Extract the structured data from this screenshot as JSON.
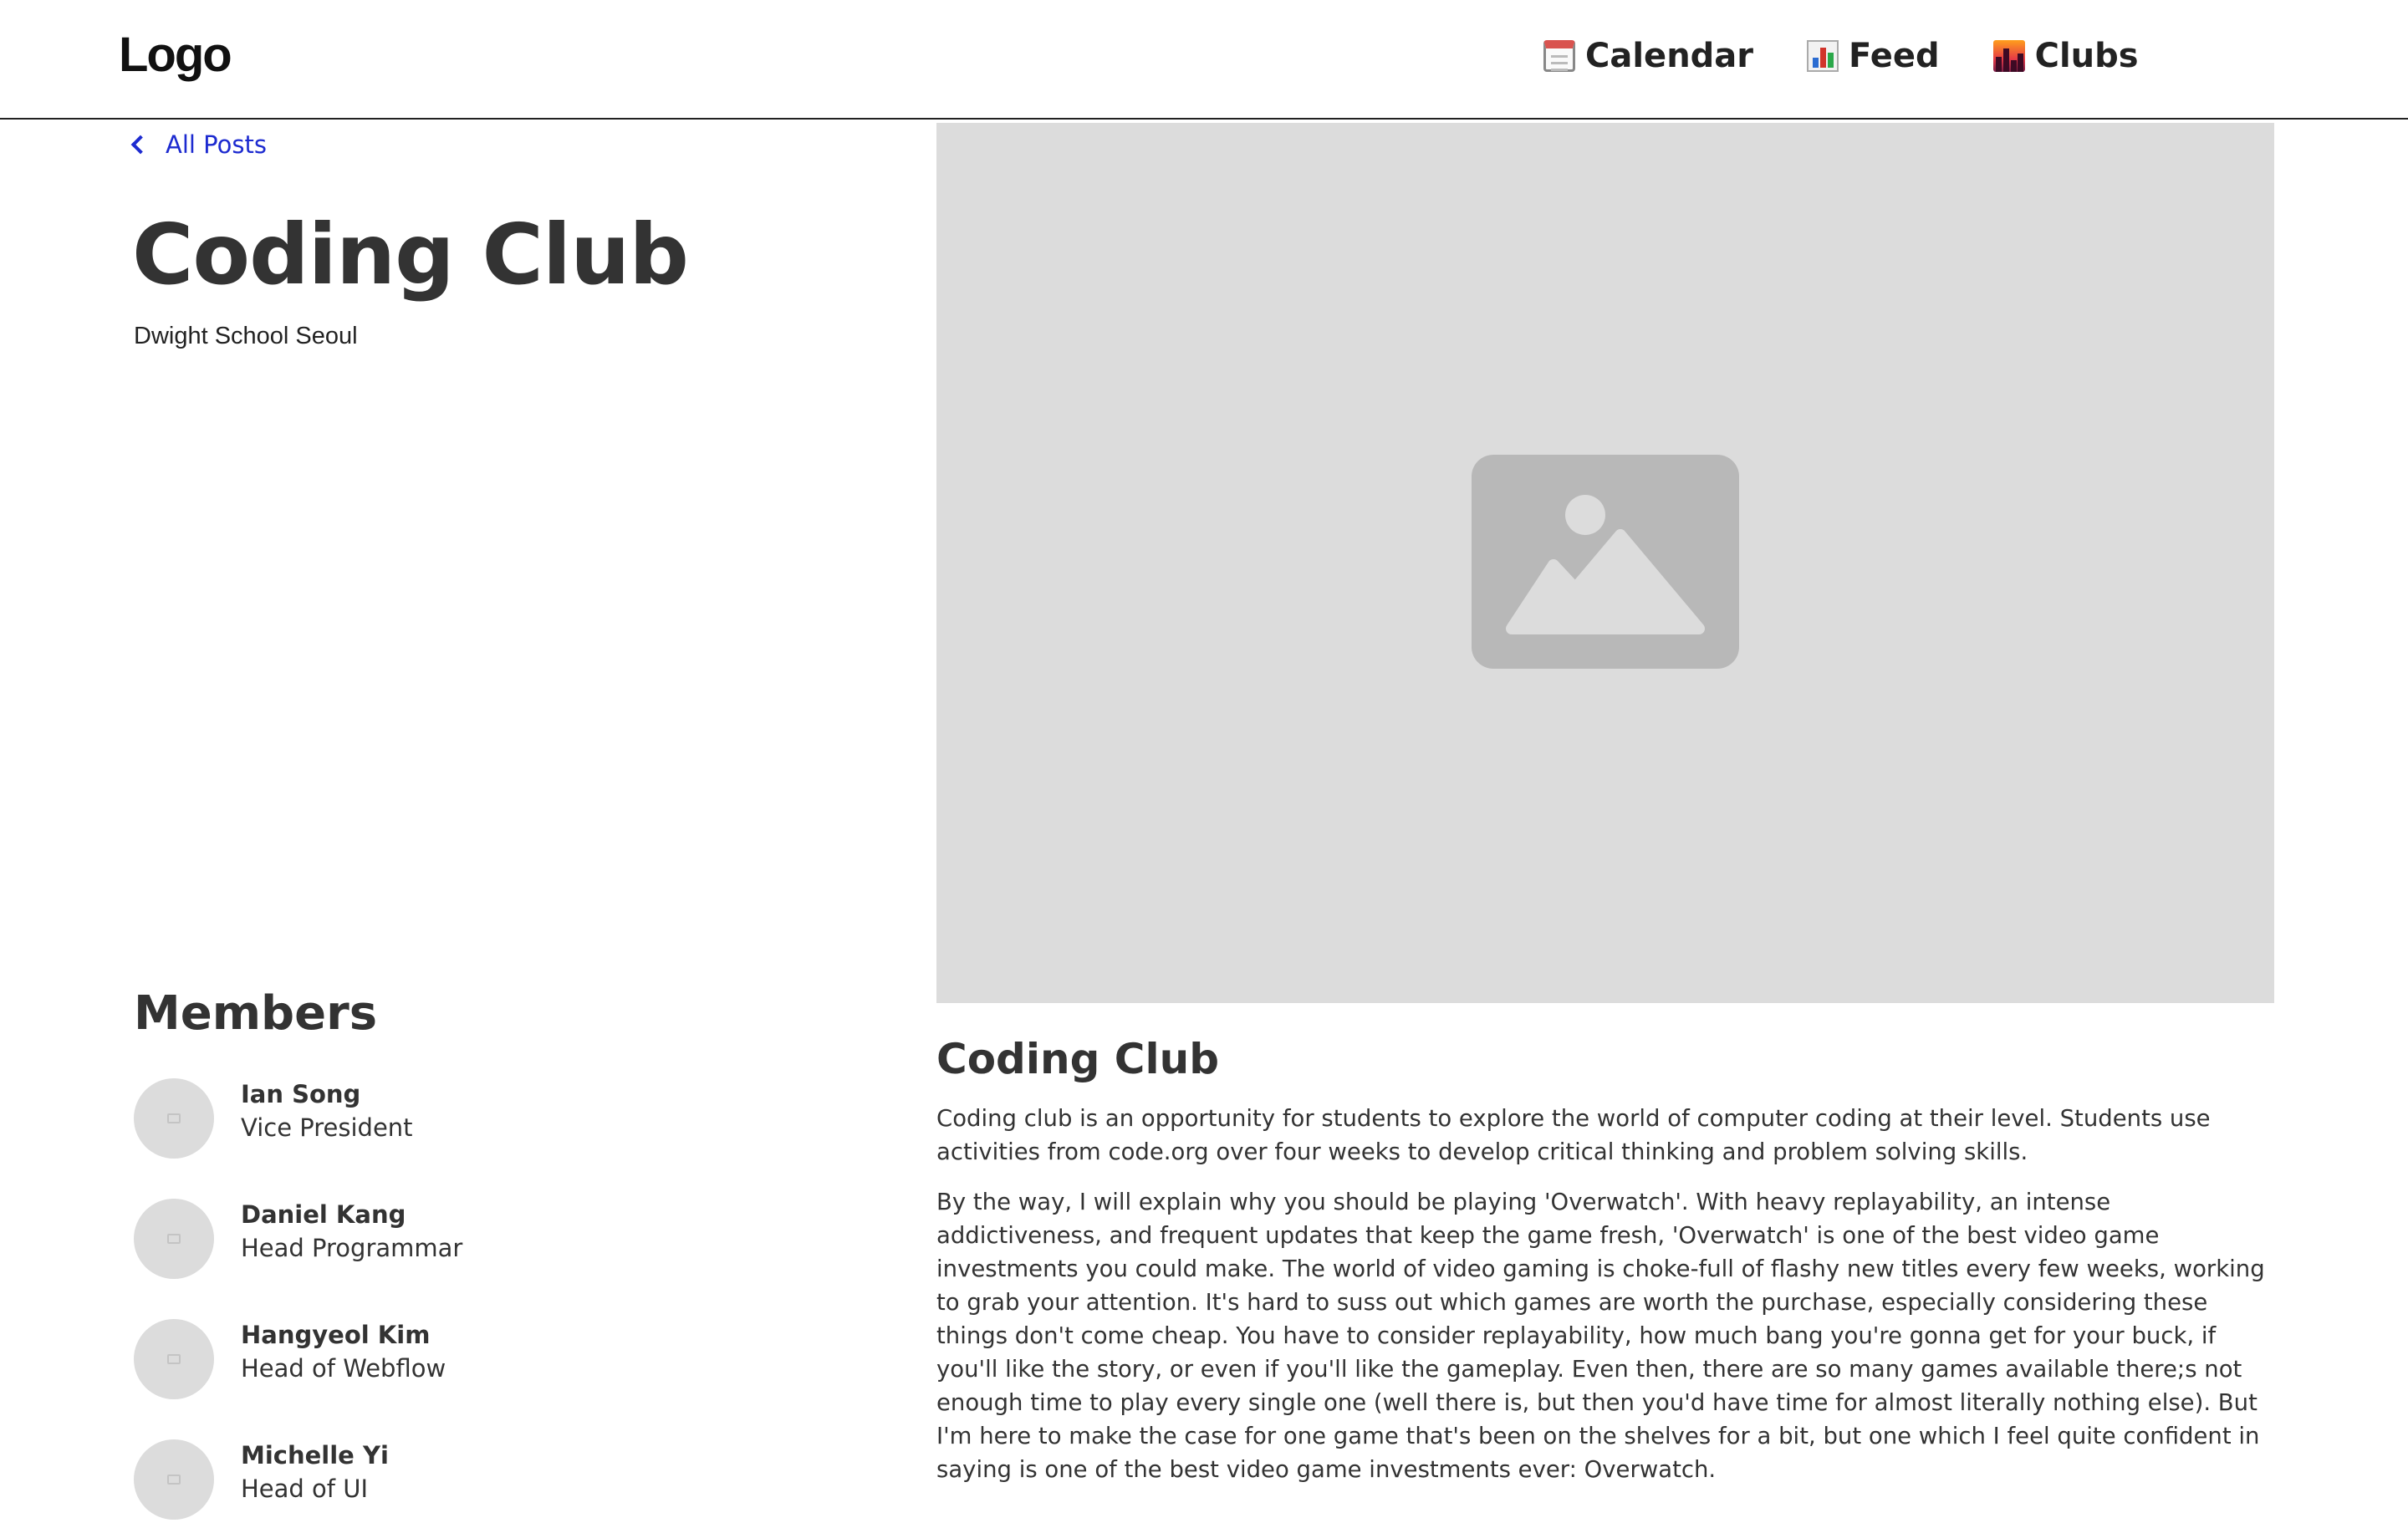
{
  "nav": {
    "logo": "Logo",
    "links": [
      {
        "label": "Calendar",
        "icon": "calendar-icon"
      },
      {
        "label": "Feed",
        "icon": "bar-chart-icon"
      },
      {
        "label": "Clubs",
        "icon": "cityscape-icon"
      }
    ]
  },
  "back_link": {
    "label": "All Posts",
    "icon": "chevron-left-icon"
  },
  "club": {
    "title": "Coding Club",
    "school": "Dwight School Seoul"
  },
  "hero": {
    "icon": "image-placeholder-icon"
  },
  "members": {
    "heading": "Members",
    "items": [
      {
        "name": "Ian Song",
        "role": "Vice President"
      },
      {
        "name": "Daniel Kang",
        "role": "Head Programmar"
      },
      {
        "name": "Hangyeol Kim",
        "role": "Head of Webflow"
      },
      {
        "name": "Michelle Yi",
        "role": "Head of UI"
      }
    ]
  },
  "post": {
    "heading": "Coding Club",
    "paragraphs": [
      "Coding club is an opportunity for students to explore the world of computer coding at their level. Students use activities from code.org over four weeks to develop critical thinking and problem solving skills.",
      "By the way, I will explain why you should be playing 'Overwatch'. With heavy replayability, an intense addictiveness, and frequent updates that keep the game fresh, 'Overwatch' is one of the best video game investments you could make. The world of video gaming is choke-full of flashy new titles every few weeks, working to grab your attention. It's hard to suss out which games are worth the purchase, especially considering these things don't come cheap. You have to consider replayability, how much bang you're gonna get for your buck, if you'll like the story, or even if you'll like the gameplay. Even then, there are so many games available there;s not enough time to play every single one (well there is, but then you'd have time for almost literally nothing else). But I'm here to make the case for one game that's been on the shelves for a bit, but one which I feel quite confident in saying is one of the best video game investments ever: Overwatch."
    ]
  },
  "colors": {
    "link": "#1d2bd0",
    "placeholder": "#dcdcdc",
    "text": "#333333"
  }
}
